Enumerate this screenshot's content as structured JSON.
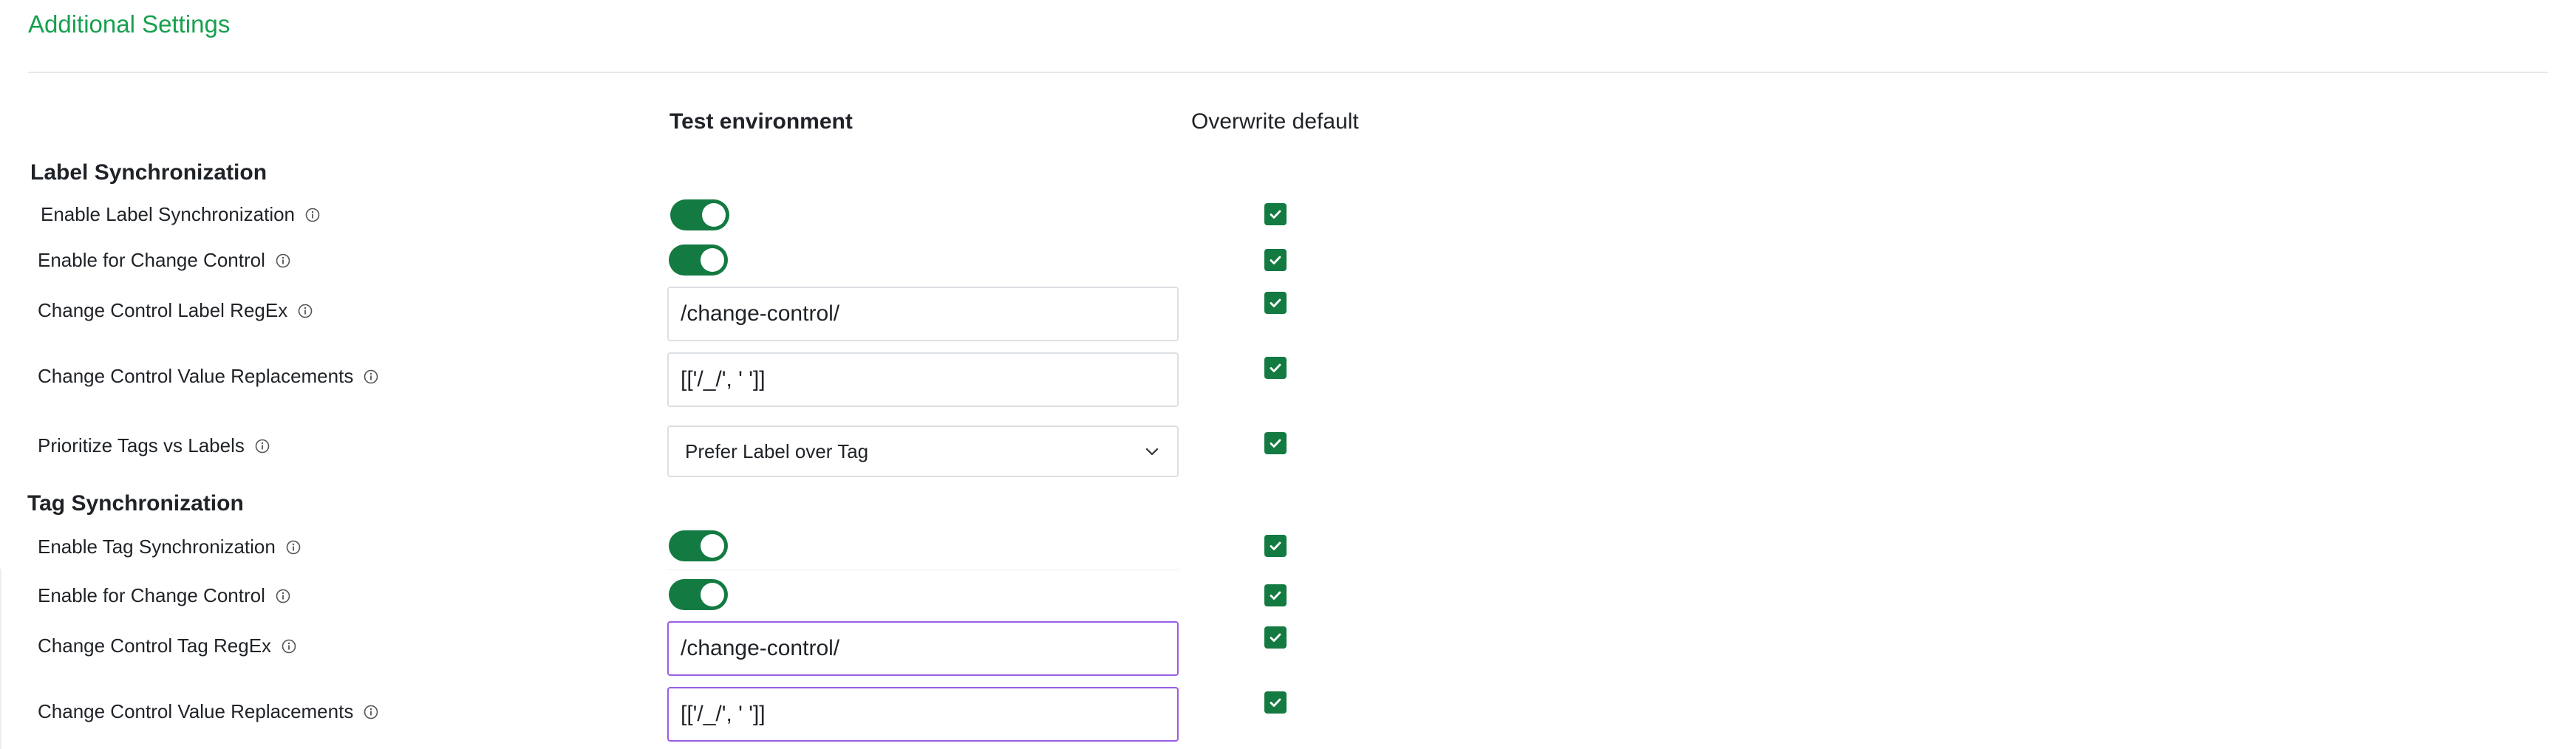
{
  "header": {
    "title": "Additional Settings"
  },
  "columns": {
    "test_environment": "Test environment",
    "overwrite_default": "Overwrite default"
  },
  "label_sync": {
    "heading": "Label Synchronization",
    "enable_label_sync": {
      "label": "Enable Label Synchronization",
      "on": true,
      "overwrite": true
    },
    "enable_change_control": {
      "label": "Enable for Change Control",
      "on": true,
      "overwrite": true
    },
    "label_regex": {
      "label": "Change Control Label RegEx",
      "value": "/change-control/",
      "overwrite": true
    },
    "value_replacements": {
      "label": "Change Control Value Replacements",
      "value": "[['/_/', ' ']]",
      "overwrite": true
    },
    "prioritize": {
      "label": "Prioritize Tags vs Labels",
      "selected": "Prefer Label over Tag",
      "overwrite": true
    }
  },
  "tag_sync": {
    "heading": "Tag Synchronization",
    "enable_tag_sync": {
      "label": "Enable Tag Synchronization",
      "on": true,
      "overwrite": true
    },
    "enable_change_control": {
      "label": "Enable for Change Control",
      "on": true,
      "overwrite": true
    },
    "tag_regex": {
      "label": "Change Control Tag RegEx",
      "value": "/change-control/",
      "overwrite": true
    },
    "value_replacements": {
      "label": "Change Control Value Replacements",
      "value": "[['/_/', ' ']]",
      "overwrite": true
    }
  },
  "colors": {
    "accent_green": "#137a42",
    "title_green": "#17a04f",
    "focus_purple": "#9b5de5"
  },
  "icons": {
    "info": "info-circle-icon",
    "check": "checkmark-icon",
    "chevron": "chevron-down-icon"
  }
}
